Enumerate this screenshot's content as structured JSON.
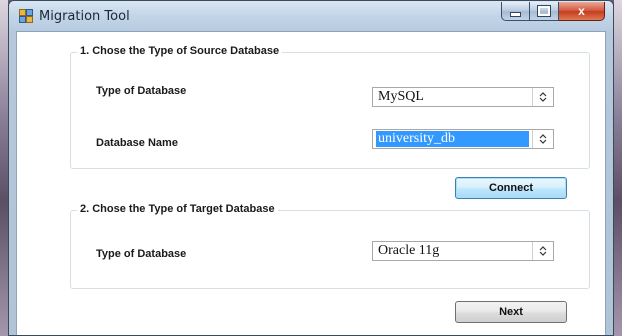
{
  "window": {
    "title": "Migration Tool",
    "controls": {
      "minimize_icon": "minimize-icon",
      "maximize_icon": "maximize-icon",
      "close_icon": "close-icon",
      "close_glyph": "x"
    }
  },
  "source": {
    "legend": "1. Chose the Type of Source Database",
    "db_type_label": "Type of Database",
    "db_type_value": "MySQL",
    "db_name_label": "Database Name",
    "db_name_value": "university_db"
  },
  "connect_label": "Connect",
  "target": {
    "legend": "2. Chose the Type of Target Database",
    "db_type_label": "Type of Database",
    "db_type_value": "Oracle 11g"
  },
  "next_label": "Next",
  "colors": {
    "selection": "#3399ff",
    "close_button": "#c43c1e",
    "focus_border": "#3c7fb1"
  }
}
